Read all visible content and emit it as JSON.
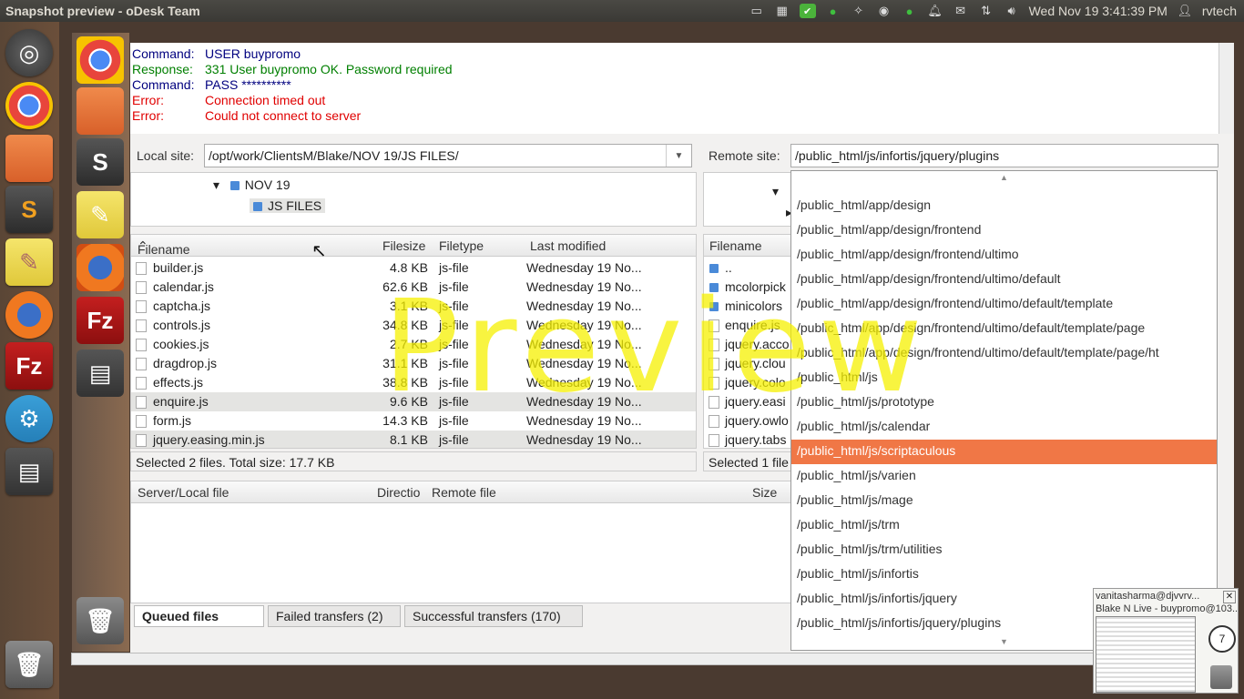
{
  "topbar": {
    "title": "Snapshot preview - oDesk Team",
    "datetime": "Wed Nov 19  3:41:39 PM",
    "user": "rvtech"
  },
  "icons": {
    "launcher": [
      "ubuntu-icon",
      "chrome-icon",
      "folder-icon",
      "sublime-icon",
      "notes-icon",
      "firefox-icon",
      "filezilla-icon",
      "settings-icon",
      "workspace-icon",
      "trash-icon"
    ]
  },
  "log": [
    {
      "key": "Command:",
      "value": "USER buypromo",
      "type": "cmd"
    },
    {
      "key": "Response:",
      "value": "331 User buypromo OK. Password required",
      "type": "resp"
    },
    {
      "key": "Command:",
      "value": "PASS **********",
      "type": "cmd"
    },
    {
      "key": "Error:",
      "value": "Connection timed out",
      "type": "err"
    },
    {
      "key": "Error:",
      "value": "Could not connect to server",
      "type": "err"
    }
  ],
  "local": {
    "label": "Local site:",
    "path": "/opt/work/ClientsM/Blake/NOV 19/JS FILES/",
    "tree": [
      "NOV 19",
      "JS FILES"
    ],
    "columns": [
      "Filename",
      "Filesize",
      "Filetype",
      "Last modified"
    ],
    "files": [
      {
        "name": "builder.js",
        "size": "4.8 KB",
        "type": "js-file",
        "modified": "Wednesday 19 No...",
        "selected": false
      },
      {
        "name": "calendar.js",
        "size": "62.6 KB",
        "type": "js-file",
        "modified": "Wednesday 19 No...",
        "selected": false
      },
      {
        "name": "captcha.js",
        "size": "3.1 KB",
        "type": "js-file",
        "modified": "Wednesday 19 No...",
        "selected": false
      },
      {
        "name": "controls.js",
        "size": "34.8 KB",
        "type": "js-file",
        "modified": "Wednesday 19 No...",
        "selected": false
      },
      {
        "name": "cookies.js",
        "size": "2.7 KB",
        "type": "js-file",
        "modified": "Wednesday 19 No...",
        "selected": false
      },
      {
        "name": "dragdrop.js",
        "size": "31.1 KB",
        "type": "js-file",
        "modified": "Wednesday 19 No...",
        "selected": false
      },
      {
        "name": "effects.js",
        "size": "38.8 KB",
        "type": "js-file",
        "modified": "Wednesday 19 No...",
        "selected": false
      },
      {
        "name": "enquire.js",
        "size": "9.6 KB",
        "type": "js-file",
        "modified": "Wednesday 19 No...",
        "selected": true
      },
      {
        "name": "form.js",
        "size": "14.3 KB",
        "type": "js-file",
        "modified": "Wednesday 19 No...",
        "selected": false
      },
      {
        "name": "jquery.easing.min.js",
        "size": "8.1 KB",
        "type": "js-file",
        "modified": "Wednesday 19 No...",
        "selected": true
      }
    ],
    "status": "Selected 2 files. Total size: 17.7 KB"
  },
  "remote": {
    "label": "Remote site:",
    "path": "/public_html/js/infortis/jquery/plugins",
    "column": "Filename",
    "files": [
      "..",
      "mcolorpick",
      "minicolors",
      "enquire.js",
      "jquery.acco",
      "jquery.clou",
      "jquery.colo",
      "jquery.easi",
      "jquery.owlo",
      "jquery.tabs"
    ],
    "status": "Selected 1 file"
  },
  "dropdown": {
    "items": [
      "/public_html/app/design",
      "/public_html/app/design/frontend",
      "/public_html/app/design/frontend/ultimo",
      "/public_html/app/design/frontend/ultimo/default",
      "/public_html/app/design/frontend/ultimo/default/template",
      "/public_html/app/design/frontend/ultimo/default/template/page",
      "/public_html/app/design/frontend/ultimo/default/template/page/ht",
      "/public_html/js",
      "/public_html/js/prototype",
      "/public_html/js/calendar",
      "/public_html/js/scriptaculous",
      "/public_html/js/varien",
      "/public_html/js/mage",
      "/public_html/js/trm",
      "/public_html/js/trm/utilities",
      "/public_html/js/infortis",
      "/public_html/js/infortis/jquery",
      "/public_html/js/infortis/jquery/plugins"
    ],
    "highlighted": 10
  },
  "queue": {
    "columns": [
      "Server/Local file",
      "Directio",
      "Remote file",
      "Size"
    ],
    "tabs": [
      "Queued files",
      "Failed transfers (2)",
      "Successful transfers (170)"
    ]
  },
  "watermark": "Preview",
  "widget": {
    "user": "vanitasharma@djvvrv...",
    "session": "Blake N Live - buypromo@103...",
    "count": "7"
  },
  "colors": {
    "accent": "#f07746",
    "command": "#00007f",
    "response": "#007f00",
    "error": "#e00000",
    "watermark": "#f5f000"
  }
}
